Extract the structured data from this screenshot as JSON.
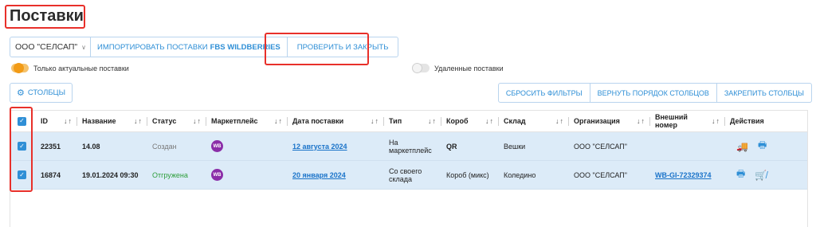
{
  "page": {
    "title": "Поставки"
  },
  "toolbar": {
    "org_select": "ООО \"СЕЛСАП\"",
    "import_prefix": "ИМПОРТИРОВАТЬ ПОСТАВКИ",
    "import_bold": "FBS WILDBERRIES",
    "check_close": "ПРОВЕРИТЬ И ЗАКРЫТЬ"
  },
  "toggles": {
    "actual_label": "Только актуальные поставки",
    "actual_on": true,
    "deleted_label": "Удаленные поставки",
    "deleted_on": false
  },
  "buttons": {
    "columns": "СТОЛБЦЫ",
    "reset_filters": "СБРОСИТЬ ФИЛЬТРЫ",
    "restore_order": "ВЕРНУТЬ ПОРЯДОК СТОЛБЦОВ",
    "pin_columns": "ЗАКРЕПИТЬ СТОЛБЦЫ"
  },
  "table": {
    "sort_arrows": "↓↑",
    "headers": {
      "id": "ID",
      "name": "Название",
      "status": "Статус",
      "marketplace": "Маркетплейс",
      "date": "Дата поставки",
      "type": "Тип",
      "box": "Короб",
      "warehouse": "Склад",
      "org": "Организация",
      "ext_line1": "Внешний",
      "ext_line2": "номер",
      "actions": "Действия"
    },
    "rows": [
      {
        "id": "22351",
        "name": "14.08",
        "status": "Создан",
        "marketplace_badge": "WB",
        "date": "12 августа 2024",
        "type_line1": "На",
        "type_line2": "маркетплейс",
        "box": "QR",
        "warehouse": "Вешки",
        "org": "ООО \"СЕЛСАП\"",
        "external": ""
      },
      {
        "id": "16874",
        "name": "19.01.2024 09:30",
        "status": "Отгружена",
        "marketplace_badge": "WB",
        "date": "20 января 2024",
        "type_line1": "Со своего",
        "type_line2": "склада",
        "box": "Короб (микс)",
        "warehouse": "Коледино",
        "org": "ООО \"СЕЛСАП\"",
        "external": "WB-GI-72329374"
      }
    ]
  },
  "colors": {
    "accent": "#2f8fd6",
    "selected_row": "#dcebf8",
    "highlight": "#e8302a",
    "toggle_on": "#f29b16",
    "status_shipped": "#2e9e3c",
    "wb_badge": "#8b2ea8"
  }
}
